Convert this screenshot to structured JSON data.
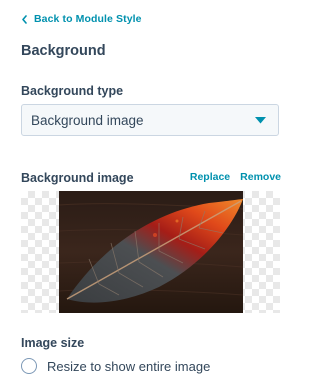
{
  "nav": {
    "back_label": "Back to Module Style"
  },
  "section": {
    "title": "Background"
  },
  "background_type": {
    "label": "Background type",
    "selected": "Background image"
  },
  "background_image": {
    "label": "Background image",
    "replace_label": "Replace",
    "remove_label": "Remove"
  },
  "image_size": {
    "label": "Image size",
    "option_1_label": "Resize to show entire image"
  },
  "colors": {
    "accent": "#0091ae",
    "text": "#33475b",
    "input_bg": "#f5f8fa",
    "input_border": "#cbd6e2"
  }
}
